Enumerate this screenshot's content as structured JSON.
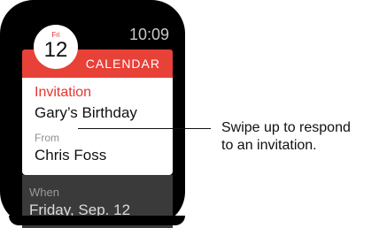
{
  "watch": {
    "time": "10:09",
    "date": {
      "day_of_week": "Fri",
      "day": "12"
    },
    "app_name": "CALENDAR",
    "notification": {
      "label": "Invitation",
      "title": "Gary’s Birthday",
      "from_label": "From",
      "from_name": "Chris Foss",
      "when_label": "When",
      "when_value": "Friday, Sep. 12"
    }
  },
  "callout": {
    "line1": "Swipe up to respond",
    "line2": "to an invitation."
  },
  "colors": {
    "accent": "#e84138",
    "bezel": "#000000",
    "card": "#ffffff"
  }
}
